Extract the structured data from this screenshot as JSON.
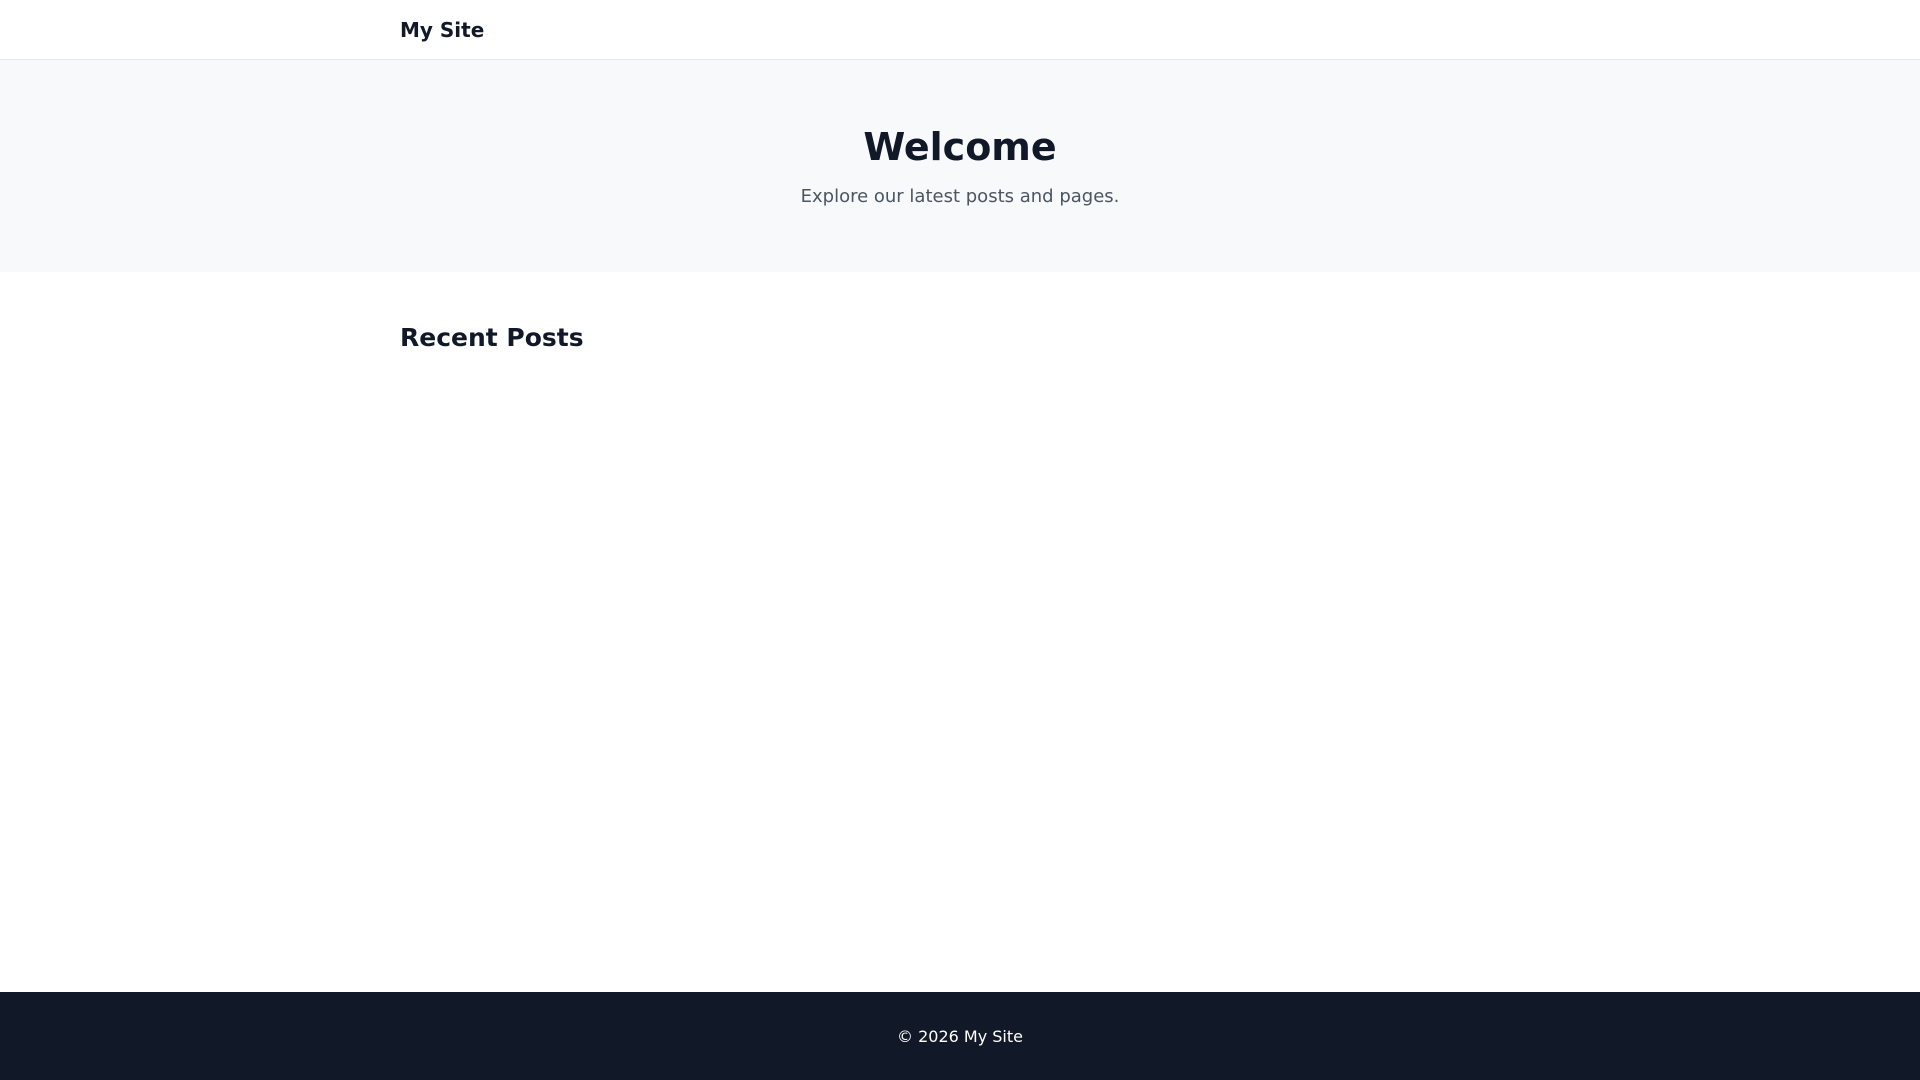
{
  "header": {
    "site_title": "My Site"
  },
  "hero": {
    "title": "Welcome",
    "subtitle": "Explore our latest posts and pages."
  },
  "main": {
    "section_title": "Recent Posts",
    "posts": []
  },
  "footer": {
    "copyright": "© 2026 My Site"
  },
  "colors": {
    "text_primary": "#111827",
    "text_muted": "#4b5563",
    "hero_background": "#f8f9fb",
    "footer_background": "#111827",
    "border": "#e5e7eb"
  }
}
